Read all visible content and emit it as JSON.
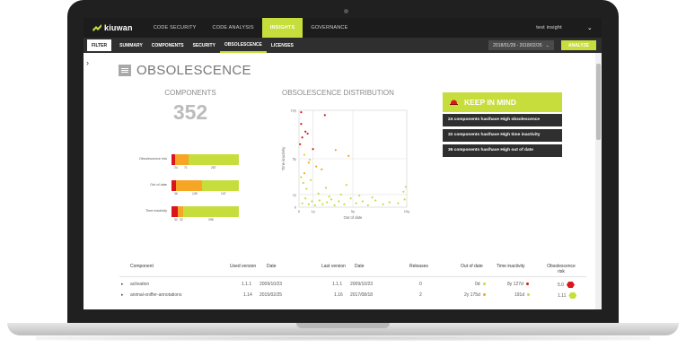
{
  "app": {
    "logo": "kiuwan"
  },
  "nav": {
    "items": [
      "CODE SECURITY",
      "CODE ANALYSIS",
      "INSIGHTS",
      "GOVERNANCE"
    ],
    "active": "INSIGHTS",
    "user": "test insight"
  },
  "subnav": {
    "filter": "FILTER",
    "items": [
      "SUMMARY",
      "COMPONENTS",
      "SECURITY",
      "OBSOLESCENCE",
      "LICENSES"
    ],
    "active": "OBSOLESCENCE",
    "date_range": "2018/01/28 - 2018/02/26",
    "analyze": "ANALYZE"
  },
  "page": {
    "title": "OBSOLESCENCE"
  },
  "components": {
    "heading": "COMPONENTS",
    "count": "352",
    "bars": [
      {
        "label": "Obsolescence risk",
        "segments": [
          0.05,
          0.2,
          0.75
        ],
        "ticks": [
          "24",
          "71",
          "257"
        ]
      },
      {
        "label": "Out of date",
        "segments": [
          0.06,
          0.39,
          0.55
        ],
        "ticks": [
          "36",
          "139",
          "137"
        ]
      },
      {
        "label": "Time inactivity",
        "segments": [
          0.09,
          0.08,
          0.83
        ],
        "ticks": [
          "32",
          "22",
          "298"
        ]
      }
    ]
  },
  "chart_data": {
    "type": "scatter",
    "title": "OBSOLESCENCE DISTRIBUTION",
    "xlabel": "Out of date",
    "ylabel": "Time inactivity",
    "x_ticks": [
      "0",
      "1y",
      "5y",
      "10y"
    ],
    "y_ticks": [
      "10y",
      "5y",
      "1y",
      "0"
    ],
    "grid": true,
    "series": [
      {
        "color": "#d8161b",
        "points": [
          [
            0.2,
            9.8
          ],
          [
            0.2,
            8.6
          ],
          [
            0.3,
            7.2
          ],
          [
            0.1,
            6.5
          ],
          [
            2.4,
            9.5
          ],
          [
            0.6,
            7.8
          ],
          [
            1.3,
            6.0
          ],
          [
            0.8,
            7.6
          ]
        ]
      },
      {
        "color": "#f6a524",
        "points": [
          [
            0.9,
            4.6
          ],
          [
            2.1,
            3.9
          ],
          [
            3.4,
            5.9
          ],
          [
            0.5,
            3.5
          ],
          [
            4.6,
            5.3
          ],
          [
            1.6,
            4.2
          ]
        ]
      },
      {
        "color": "#c6dd3c",
        "points": [
          [
            0.3,
            0.4
          ],
          [
            0.6,
            0.9
          ],
          [
            0.9,
            0.3
          ],
          [
            1.2,
            0.6
          ],
          [
            1.5,
            0.2
          ],
          [
            1.9,
            0.7
          ],
          [
            2.2,
            0.3
          ],
          [
            2.6,
            0.5
          ],
          [
            3.0,
            0.8
          ],
          [
            3.3,
            0.2
          ],
          [
            3.7,
            0.6
          ],
          [
            4.2,
            0.3
          ],
          [
            4.8,
            0.9
          ],
          [
            5.3,
            0.4
          ],
          [
            5.9,
            0.6
          ],
          [
            6.4,
            0.2
          ],
          [
            7.1,
            0.7
          ],
          [
            7.8,
            0.3
          ],
          [
            8.4,
            0.5
          ],
          [
            9.2,
            0.4
          ],
          [
            9.8,
            0.8
          ],
          [
            9.9,
            2.1
          ],
          [
            9.7,
            1.6
          ],
          [
            0.4,
            2.5
          ],
          [
            0.7,
            1.9
          ],
          [
            1.1,
            2.8
          ],
          [
            1.8,
            1.4
          ],
          [
            2.8,
            1.1
          ],
          [
            3.9,
            1.3
          ],
          [
            0.2,
            3.1
          ],
          [
            5.6,
            1.2
          ],
          [
            6.8,
            1.0
          ],
          [
            0.5,
            5.4
          ],
          [
            1.0,
            4.9
          ],
          [
            2.5,
            2.0
          ],
          [
            4.4,
            2.3
          ]
        ]
      }
    ]
  },
  "keep_in_mind": {
    "heading": "KEEP IN MIND",
    "items": [
      "24 components has/have High obsolescence",
      "32 components has/have High time inactivity",
      "36 components has/have High out of date"
    ]
  },
  "table": {
    "headers": {
      "component": "Component",
      "used_version": "Used version",
      "used_date": "Date",
      "last_version": "Last version",
      "last_date": "Date",
      "releases": "Releases",
      "out_of_date": "Out of date",
      "time_inactivity": "Time inactivity",
      "obsolescence_risk": "Obsolescence risk"
    },
    "rows": [
      {
        "component": "activation",
        "used_version": "1.1.1",
        "used_date": "2009/10/23",
        "last_version": "1.1.1",
        "last_date": "2009/10/23",
        "releases": "0",
        "out_of_date": "0d",
        "out_color": "#c6dd3c",
        "time_inactivity": "8y 127d",
        "time_color": "#d8161b",
        "risk": "5.0",
        "risk_color": "#d8161b"
      },
      {
        "component": "animal-sniffer-annotations",
        "used_version": "1.14",
        "used_date": "2015/02/25",
        "last_version": "1.16",
        "last_date": "2017/08/18",
        "releases": "2",
        "out_of_date": "2y 175d",
        "out_color": "#f6a524",
        "time_inactivity": "191d",
        "time_color": "#c6dd3c",
        "risk": "1.11",
        "risk_color": "#c6dd3c"
      }
    ]
  }
}
